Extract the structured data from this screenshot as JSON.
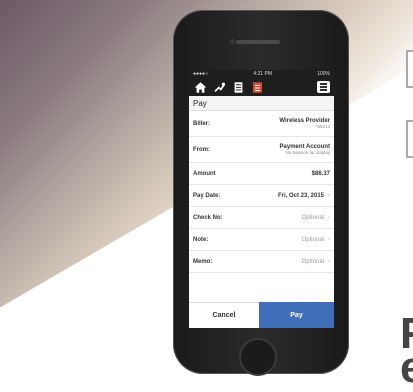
{
  "status_bar": {
    "carrier": "●●●●○",
    "time": "4:21 PM",
    "battery": "100%"
  },
  "toolbar": {
    "icons": [
      "home-icon",
      "transfer-icon",
      "document-icon",
      "bill-icon"
    ],
    "menu": "menu-icon"
  },
  "screen_title": "Pay",
  "rows": [
    {
      "label": "Biller:",
      "value": "Wireless Provider",
      "sub": "*55213"
    },
    {
      "label": "From:",
      "value": "Payment Account",
      "sub": "No balance for display"
    },
    {
      "label": "Amount",
      "value": "$86.37"
    },
    {
      "label": "Pay Date:",
      "value": "Fri, Oct 23, 2015"
    },
    {
      "label": "Check No:",
      "value": "Optional"
    },
    {
      "label": "Note:",
      "value": "Optional"
    },
    {
      "label": "Memo:",
      "value": "Optional"
    }
  ],
  "buttons": {
    "cancel": "Cancel",
    "pay": "Pay"
  },
  "colors": {
    "accent": "#3f6fb8",
    "toolbar": "#1e1e1e"
  },
  "background_glyphs": [
    "F",
    "e"
  ]
}
